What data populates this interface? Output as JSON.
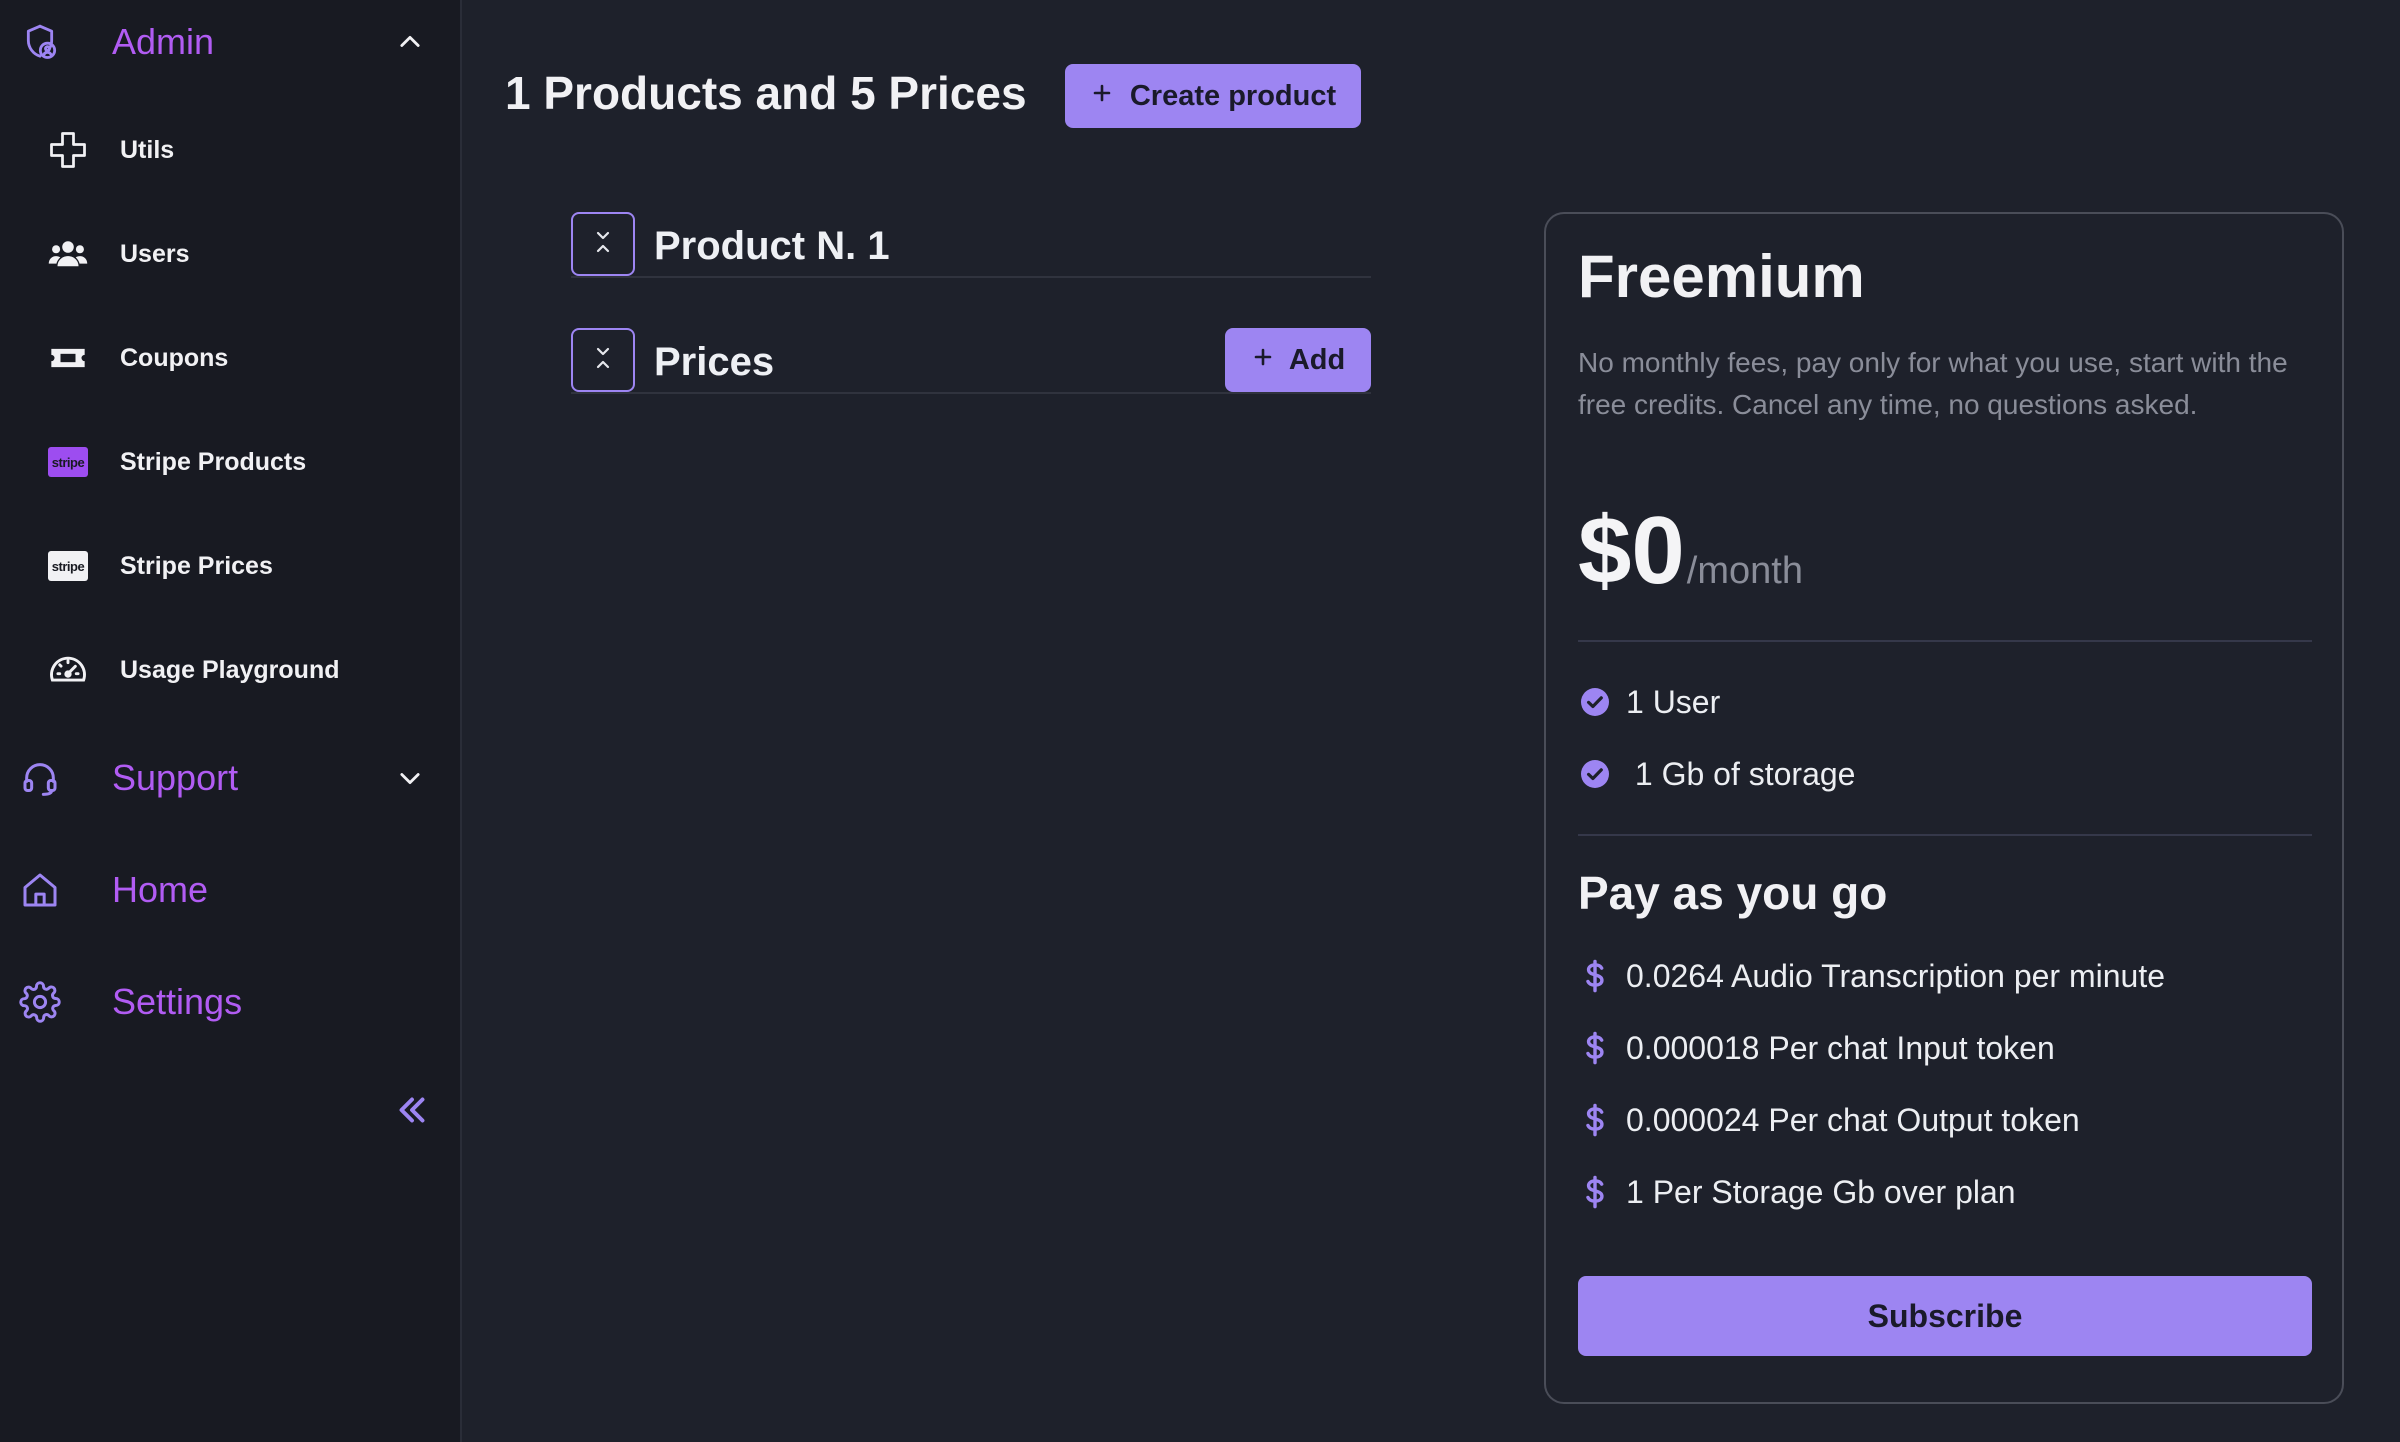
{
  "sidebar": {
    "admin": {
      "label": "Admin",
      "icon": "shield-user-icon",
      "expanded": true
    },
    "admin_items": [
      {
        "label": "Utils",
        "icon": "puzzle-icon"
      },
      {
        "label": "Users",
        "icon": "users-icon"
      },
      {
        "label": "Coupons",
        "icon": "ticket-icon"
      },
      {
        "label": "Stripe Products",
        "icon": "stripe-logo-icon",
        "badge_text": "stripe"
      },
      {
        "label": "Stripe Prices",
        "icon": "stripe-logo-icon",
        "badge_text": "stripe"
      },
      {
        "label": "Usage Playground",
        "icon": "gauge-icon"
      }
    ],
    "support": {
      "label": "Support",
      "icon": "headset-icon",
      "expanded": false
    },
    "home": {
      "label": "Home",
      "icon": "home-icon"
    },
    "settings": {
      "label": "Settings",
      "icon": "gear-icon"
    },
    "collapse_icon": "double-chevron-left-icon"
  },
  "main": {
    "title": "1 Products and 5 Prices",
    "create_product_label": "Create product",
    "product_section": {
      "title": "Product N. 1"
    },
    "prices_section": {
      "title": "Prices",
      "add_label": "Add"
    }
  },
  "plan": {
    "name": "Freemium",
    "description": "No monthly fees, pay only for what you use, start with the free credits. Cancel any time, no questions asked.",
    "price": "$0",
    "period": "/month",
    "features": [
      {
        "text": "1 User",
        "icon": "check-circle-icon"
      },
      {
        "text": " 1 Gb of storage",
        "icon": "check-circle-icon"
      }
    ],
    "payg_title": "Pay as you go",
    "payg_items": [
      {
        "text": "0.0264 Audio Transcription per minute",
        "icon": "dollar-icon"
      },
      {
        "text": "0.000018 Per chat Input token",
        "icon": "dollar-icon"
      },
      {
        "text": "0.000024 Per chat Output token",
        "icon": "dollar-icon"
      },
      {
        "text": "1 Per Storage Gb over plan",
        "icon": "dollar-icon"
      }
    ],
    "subscribe_label": "Subscribe"
  },
  "colors": {
    "accent": "#9d85f2",
    "section_label": "#b15cf3",
    "background": "#1e212b",
    "sidebar_bg": "#181a22"
  }
}
